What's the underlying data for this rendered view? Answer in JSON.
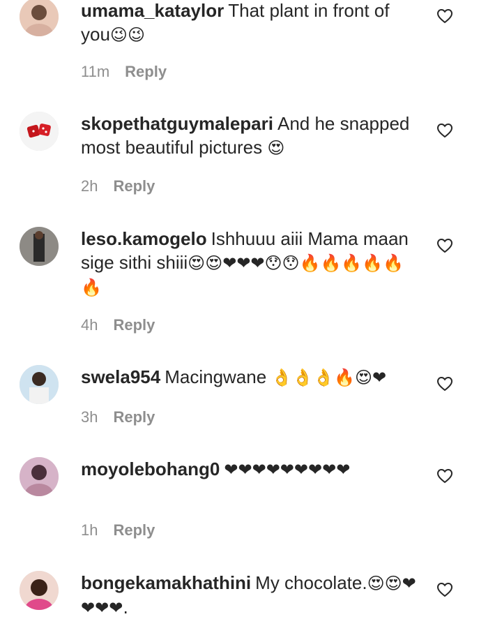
{
  "comments": [
    {
      "username": "umama_kataylor",
      "text": "That plant in front of you",
      "emoji": "😉😉",
      "time": "11m",
      "reply": "Reply",
      "avatar_colors": [
        "#e9c9b8",
        "#6b4d3d"
      ]
    },
    {
      "username": "skopethatguymalepari",
      "text": "And he snapped most beautiful pictures ",
      "emoji": "😍",
      "time": "2h",
      "reply": "Reply",
      "avatar_colors": [
        "#f4f4f4",
        "#c4161c"
      ]
    },
    {
      "username": "leso.kamogelo",
      "text": "Ishhuuu aiii Mama maan sige sithi shiii",
      "emoji": "😍😍❤❤❤😯😯🔥🔥🔥🔥🔥🔥",
      "time": "4h",
      "reply": "Reply",
      "avatar_colors": [
        "#8d8a85",
        "#2a2a2a"
      ]
    },
    {
      "username": "swela954",
      "text": "Macingwane ",
      "emoji": "👌👌👌🔥😍❤",
      "time": "3h",
      "reply": "Reply",
      "avatar_colors": [
        "#cfe3f0",
        "#3a2a22"
      ]
    },
    {
      "username": "moyolebohang0",
      "text": "",
      "emoji": "❤❤❤❤❤❤❤❤❤",
      "time": "1h",
      "reply": "Reply",
      "avatar_colors": [
        "#d6b3c8",
        "#4a2f3b"
      ]
    },
    {
      "username": "bongekamakhathini",
      "text": "My chocolate.",
      "emoji": "😍😍❤❤❤❤.",
      "time": "",
      "reply": "",
      "avatar_colors": [
        "#f0d8d0",
        "#3b2218"
      ]
    }
  ],
  "icons": {
    "like": "heart-outline-icon"
  },
  "colors": {
    "text": "#262626",
    "meta": "#8e8e8e",
    "heart_emoji": "#e0182d"
  }
}
